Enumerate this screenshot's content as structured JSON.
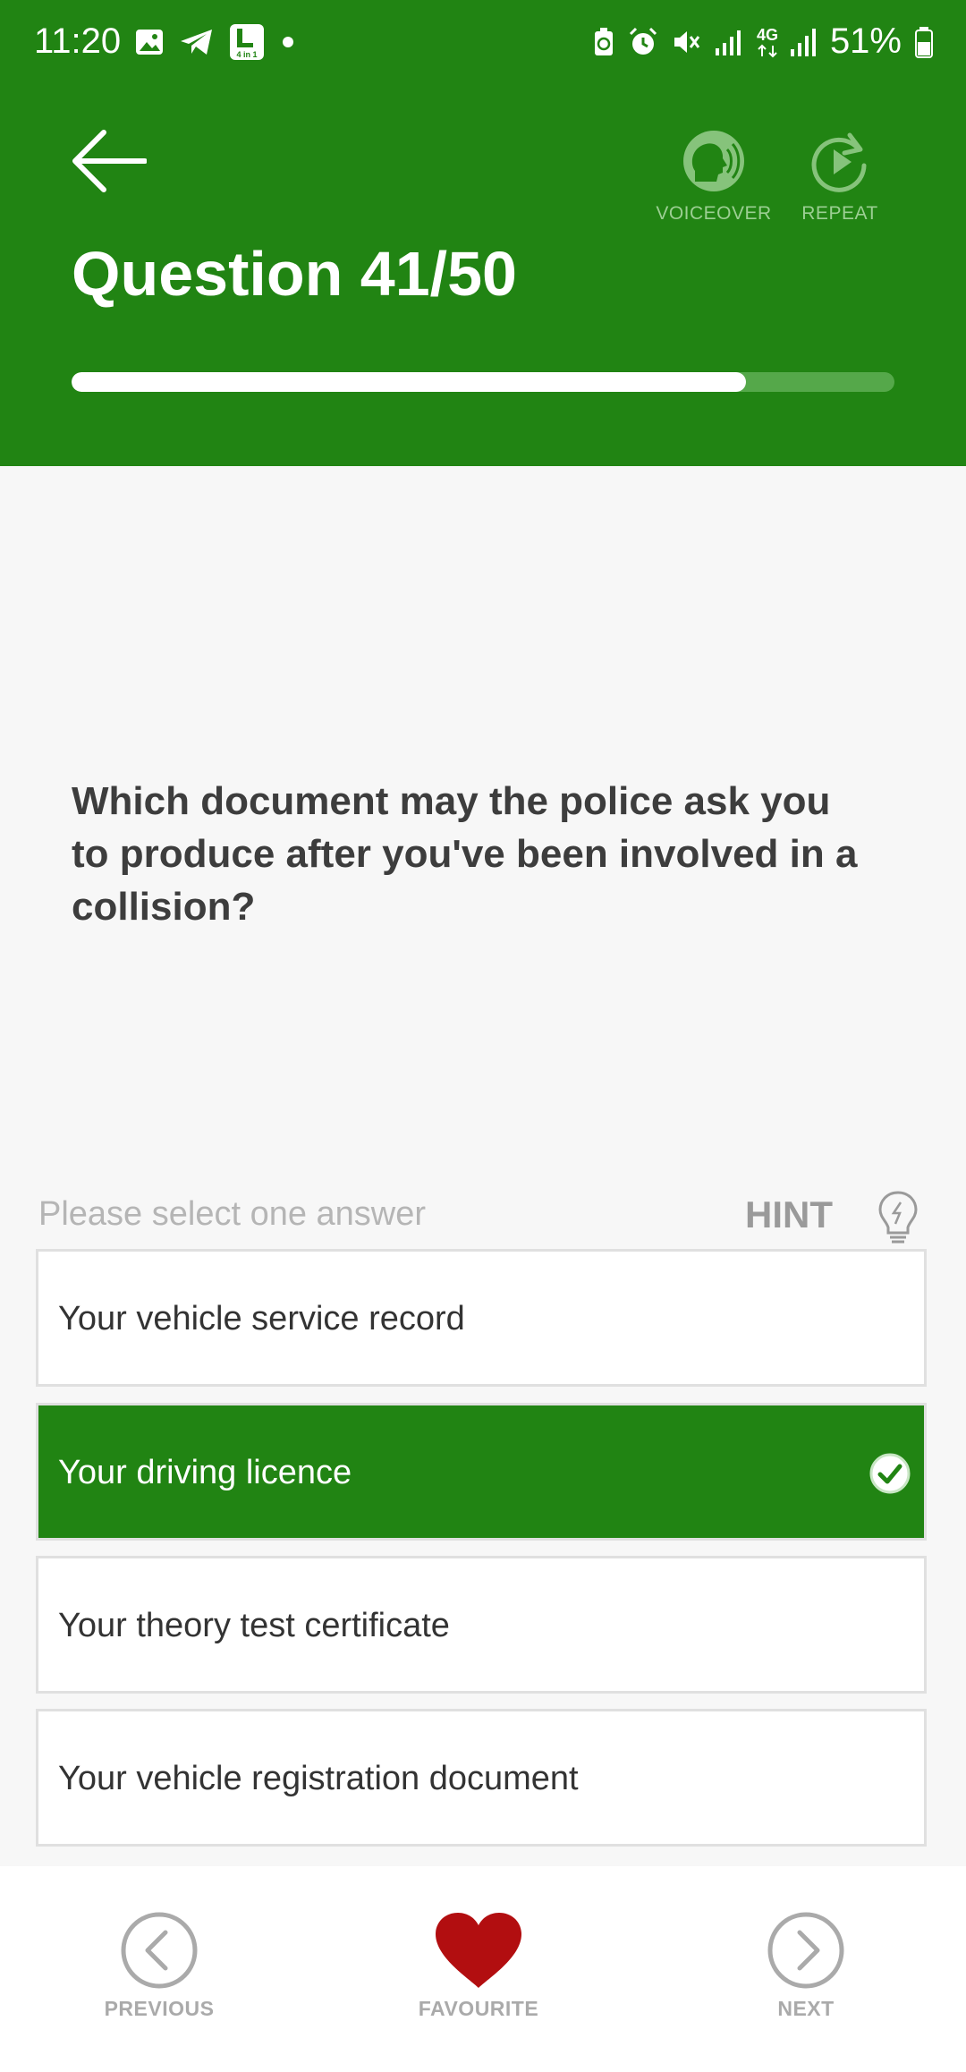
{
  "status_bar": {
    "time": "11:20",
    "battery_percent": "51%",
    "network_label": "4G",
    "icons": [
      "gallery-icon",
      "telegram-icon",
      "app-4in1-icon",
      "notification-dot-icon",
      "battery-saver-icon",
      "alarm-icon",
      "mute-icon",
      "signal-icon",
      "signal-4g-icon",
      "battery-icon"
    ],
    "app_icon_text": "4 in 1"
  },
  "header": {
    "title": "Question 41/50",
    "voiceover_label": "VOICEOVER",
    "repeat_label": "REPEAT",
    "progress_fraction": 0.82
  },
  "question": {
    "text": "Which document may the police ask you to produce after you've been involved in a collision?",
    "instruction": "Please select one answer",
    "hint_label": "HINT"
  },
  "answers": [
    {
      "label": "Your vehicle service record",
      "selected": false
    },
    {
      "label": "Your driving licence",
      "selected": true
    },
    {
      "label": "Your theory test certificate",
      "selected": false
    },
    {
      "label": "Your vehicle registration document",
      "selected": false
    }
  ],
  "bottom_nav": {
    "previous_label": "PREVIOUS",
    "favourite_label": "FAVOURITE",
    "next_label": "NEXT"
  },
  "colors": {
    "brand_green": "#218413",
    "favourite_red": "#b20e10",
    "muted_green": "#9ccf93"
  }
}
